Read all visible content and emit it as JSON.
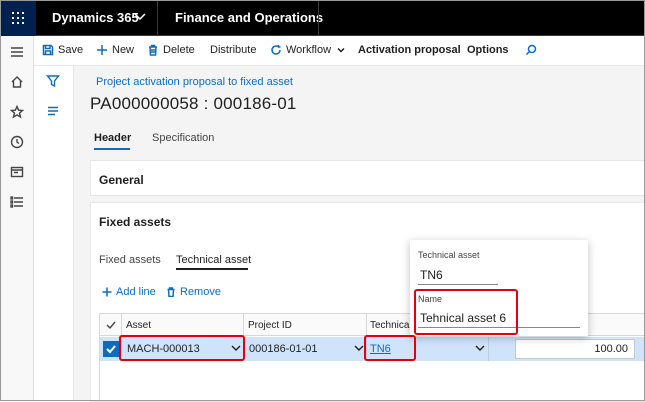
{
  "topbar": {
    "app_name": "Dynamics 365",
    "module_name": "Finance and Operations"
  },
  "actions": {
    "save": "Save",
    "new": "New",
    "delete": "Delete",
    "distribute": "Distribute",
    "workflow": "Workflow",
    "activation_proposal": "Activation proposal",
    "options": "Options"
  },
  "page": {
    "breadcrumb": "Project activation proposal to fixed asset",
    "title": "PA000000058 : 000186-01"
  },
  "tabs": {
    "header": "Header",
    "specification": "Specification"
  },
  "fasttabs": {
    "general": "General",
    "fixed_assets": "Fixed assets"
  },
  "subtabs": {
    "fixed_assets": "Fixed assets",
    "technical_asset": "Technical asset"
  },
  "grid_toolbar": {
    "add_line": "Add line",
    "remove": "Remove"
  },
  "grid": {
    "columns": [
      "Asset",
      "Project ID",
      "Technical a"
    ],
    "row": {
      "asset": "MACH-000013",
      "project_id": "000186-01-01",
      "technical_asset": "TN6",
      "amount": "100.00"
    }
  },
  "flyout": {
    "technical_asset_label": "Technical asset",
    "technical_asset_value": "TN6",
    "name_label": "Name",
    "name_value": "Tehnical asset 6"
  },
  "colors": {
    "brand_blue": "#0f6cbd",
    "highlight_red": "#e4000a",
    "waffle_bg": "#002050"
  }
}
